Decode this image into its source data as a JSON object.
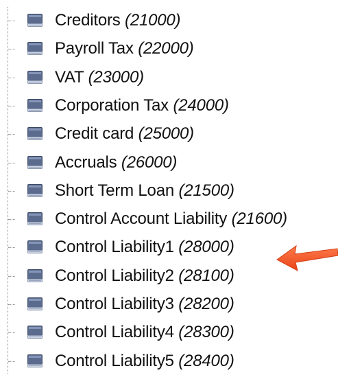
{
  "tree": {
    "items": [
      {
        "name": "Creditors",
        "code": "(21000)"
      },
      {
        "name": "Payroll Tax",
        "code": "(22000)"
      },
      {
        "name": "VAT",
        "code": "(23000)"
      },
      {
        "name": "Corporation Tax",
        "code": "(24000)"
      },
      {
        "name": "Credit card",
        "code": "(25000)"
      },
      {
        "name": "Accruals",
        "code": "(26000)"
      },
      {
        "name": "Short Term Loan",
        "code": "(21500)"
      },
      {
        "name": "Control Account Liability",
        "code": "(21600)"
      },
      {
        "name": "Control Liability1",
        "code": "(28000)"
      },
      {
        "name": "Control Liability2",
        "code": "(28100)"
      },
      {
        "name": "Control Liability3",
        "code": "(28200)"
      },
      {
        "name": "Control Liability4",
        "code": "(28300)"
      },
      {
        "name": "Control Liability5",
        "code": "(28400)"
      }
    ]
  },
  "icons": {
    "item_icon": "ledger-book-icon",
    "annotation": "arrow-pointing-left-icon"
  },
  "colors": {
    "text": "#111111",
    "tree_line": "#8a8a8a",
    "icon_body": "#5b6b8e",
    "icon_light": "#c9d3e6",
    "arrow": "#f0552a"
  }
}
